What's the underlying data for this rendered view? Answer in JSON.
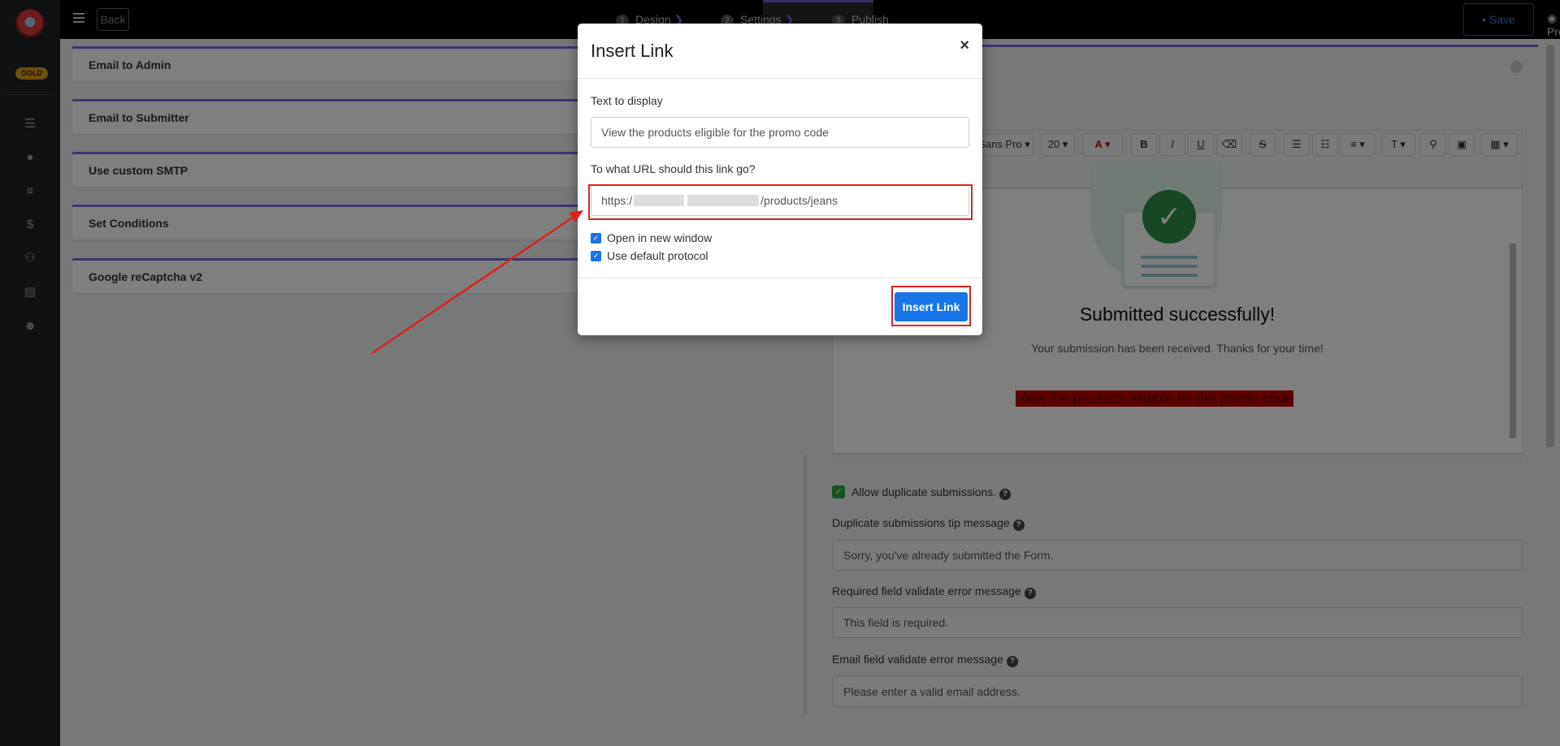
{
  "rail": {
    "badge": "GOLD",
    "icons": [
      "list-icon",
      "user-icon",
      "menu-icon",
      "dollar-icon",
      "users-icon",
      "document-icon",
      "smile-icon"
    ]
  },
  "topbar": {
    "back": "Back",
    "steps": [
      {
        "num": "1",
        "label": "Design"
      },
      {
        "num": "2",
        "label": "Settings"
      },
      {
        "num": "3",
        "label": "Publish"
      }
    ],
    "save": "Save",
    "preview": "Preview"
  },
  "sections": [
    "Email to Admin",
    "Email to Submitter",
    "Use custom SMTP",
    "Set Conditions",
    "Google reCaptcha v2"
  ],
  "editor": {
    "font_name": "Sans Pro",
    "font_size": "20",
    "success_title": "Submitted successfully!",
    "success_sub": "Your submission has been received. Thanks for your time!",
    "link_text": "View the products eligible for the promo code"
  },
  "settings": {
    "allow_duplicate_label": "Allow duplicate submissions.",
    "dup_tip_label": "Duplicate submissions tip message",
    "dup_tip_value": "Sorry, you've already submitted the Form.",
    "required_label": "Required field validate error message",
    "required_value": "This field is required.",
    "email_label": "Email field validate error message",
    "email_value": "Please enter a valid email address."
  },
  "modal": {
    "title": "Insert Link",
    "close": "×",
    "text_label": "Text to display",
    "text_value": "View the products eligible for the promo code",
    "url_label": "To what URL should this link go?",
    "url_prefix": "https:/",
    "url_suffix": "/products/jeans",
    "open_new_window": "Open in new window",
    "use_default_protocol": "Use default protocol",
    "insert_button": "Insert Link"
  },
  "colors": {
    "accent": "#7a6ad8",
    "primary": "#1976e8",
    "highlight": "#e02020",
    "success": "#28a745"
  }
}
